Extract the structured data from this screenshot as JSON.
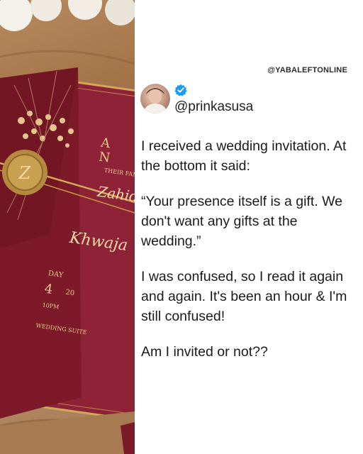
{
  "watermark": "@YABALEFTONLINE",
  "user": {
    "handle": "@prinkasusa",
    "verified_icon": "verified-badge-icon",
    "badge_color": "#1d9bf0"
  },
  "tweet": {
    "paragraphs": [
      "I received a wedding invitation. At the bottom it said:",
      "“Your presence itself is a gift. We don't want any gifts at the wedding.”",
      "I was confused, so I read it again and again. It's been an hour & I'm still confused!",
      "Am I invited or not??"
    ]
  },
  "photo": {
    "description_colors": {
      "envelope": "#7d1a2a",
      "card": "#8e2236",
      "gold": "#d3a85a"
    },
    "card_text": {
      "families": "THEIR FAMILIES",
      "name1": "Zahid",
      "name2": "Khwaja",
      "day": "DAY",
      "date": "4",
      "year": "20",
      "time": "10PM",
      "venue": "WEDDING SUITE"
    }
  }
}
